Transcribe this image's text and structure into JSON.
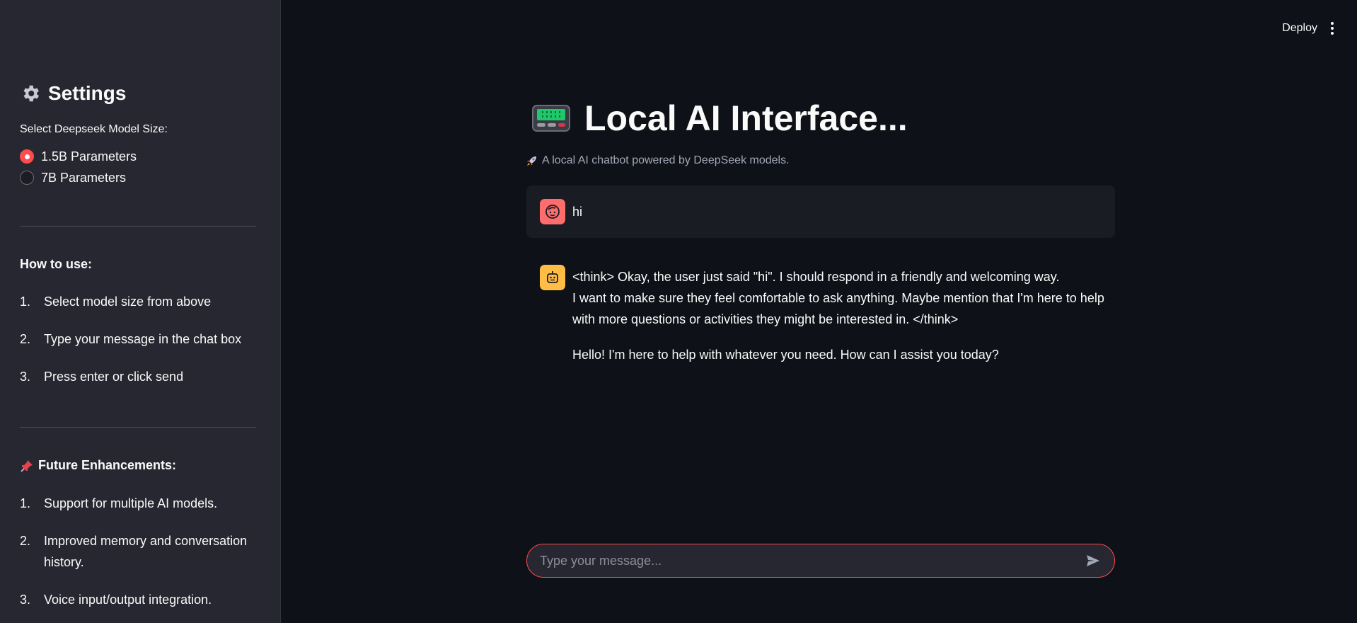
{
  "sidebar": {
    "title": "Settings",
    "title_icon": "gear-icon",
    "model_label": "Select Deepseek Model Size:",
    "model_options": [
      {
        "label": "1.5B Parameters",
        "selected": true
      },
      {
        "label": "7B Parameters",
        "selected": false
      }
    ],
    "how_to_title": "How to use:",
    "how_to_steps": [
      {
        "num": "1.",
        "text": "Select model size from above"
      },
      {
        "num": "2.",
        "text": "Type your message in the chat box"
      },
      {
        "num": "3.",
        "text": "Press enter or click send"
      }
    ],
    "future_title": "Future Enhancements:",
    "future_icon": "pushpin-icon",
    "future_items": [
      {
        "num": "1.",
        "text": "Support for multiple AI models."
      },
      {
        "num": "2.",
        "text": "Improved memory and conversation history."
      },
      {
        "num": "3.",
        "text": "Voice input/output integration."
      }
    ]
  },
  "topbar": {
    "deploy_label": "Deploy",
    "menu_icon": "kebab-menu-icon"
  },
  "main": {
    "title": "Local AI Interface...",
    "title_icon": "pager-icon",
    "caption": "A local AI chatbot powered by DeepSeek models.",
    "caption_icon": "rocket-icon"
  },
  "chat": {
    "messages": [
      {
        "role": "user",
        "avatar": "user-face-icon",
        "text": "hi"
      },
      {
        "role": "assistant",
        "avatar": "robot-icon",
        "para1_line1": "<think> Okay, the user just said \"hi\". I should respond in a friendly and welcoming way.",
        "para1_line2": "I want to make sure they feel comfortable to ask anything. Maybe mention that I'm here to help with more questions or activities they might be interested in. </think>",
        "para2": "Hello! I'm here to help with whatever you need. How can I assist you today?"
      }
    ]
  },
  "input": {
    "placeholder": "Type your message...",
    "value": "",
    "send_icon": "send-icon"
  },
  "colors": {
    "accent": "#ff4b4b",
    "background": "#0e1117",
    "sidebar": "#262730"
  }
}
